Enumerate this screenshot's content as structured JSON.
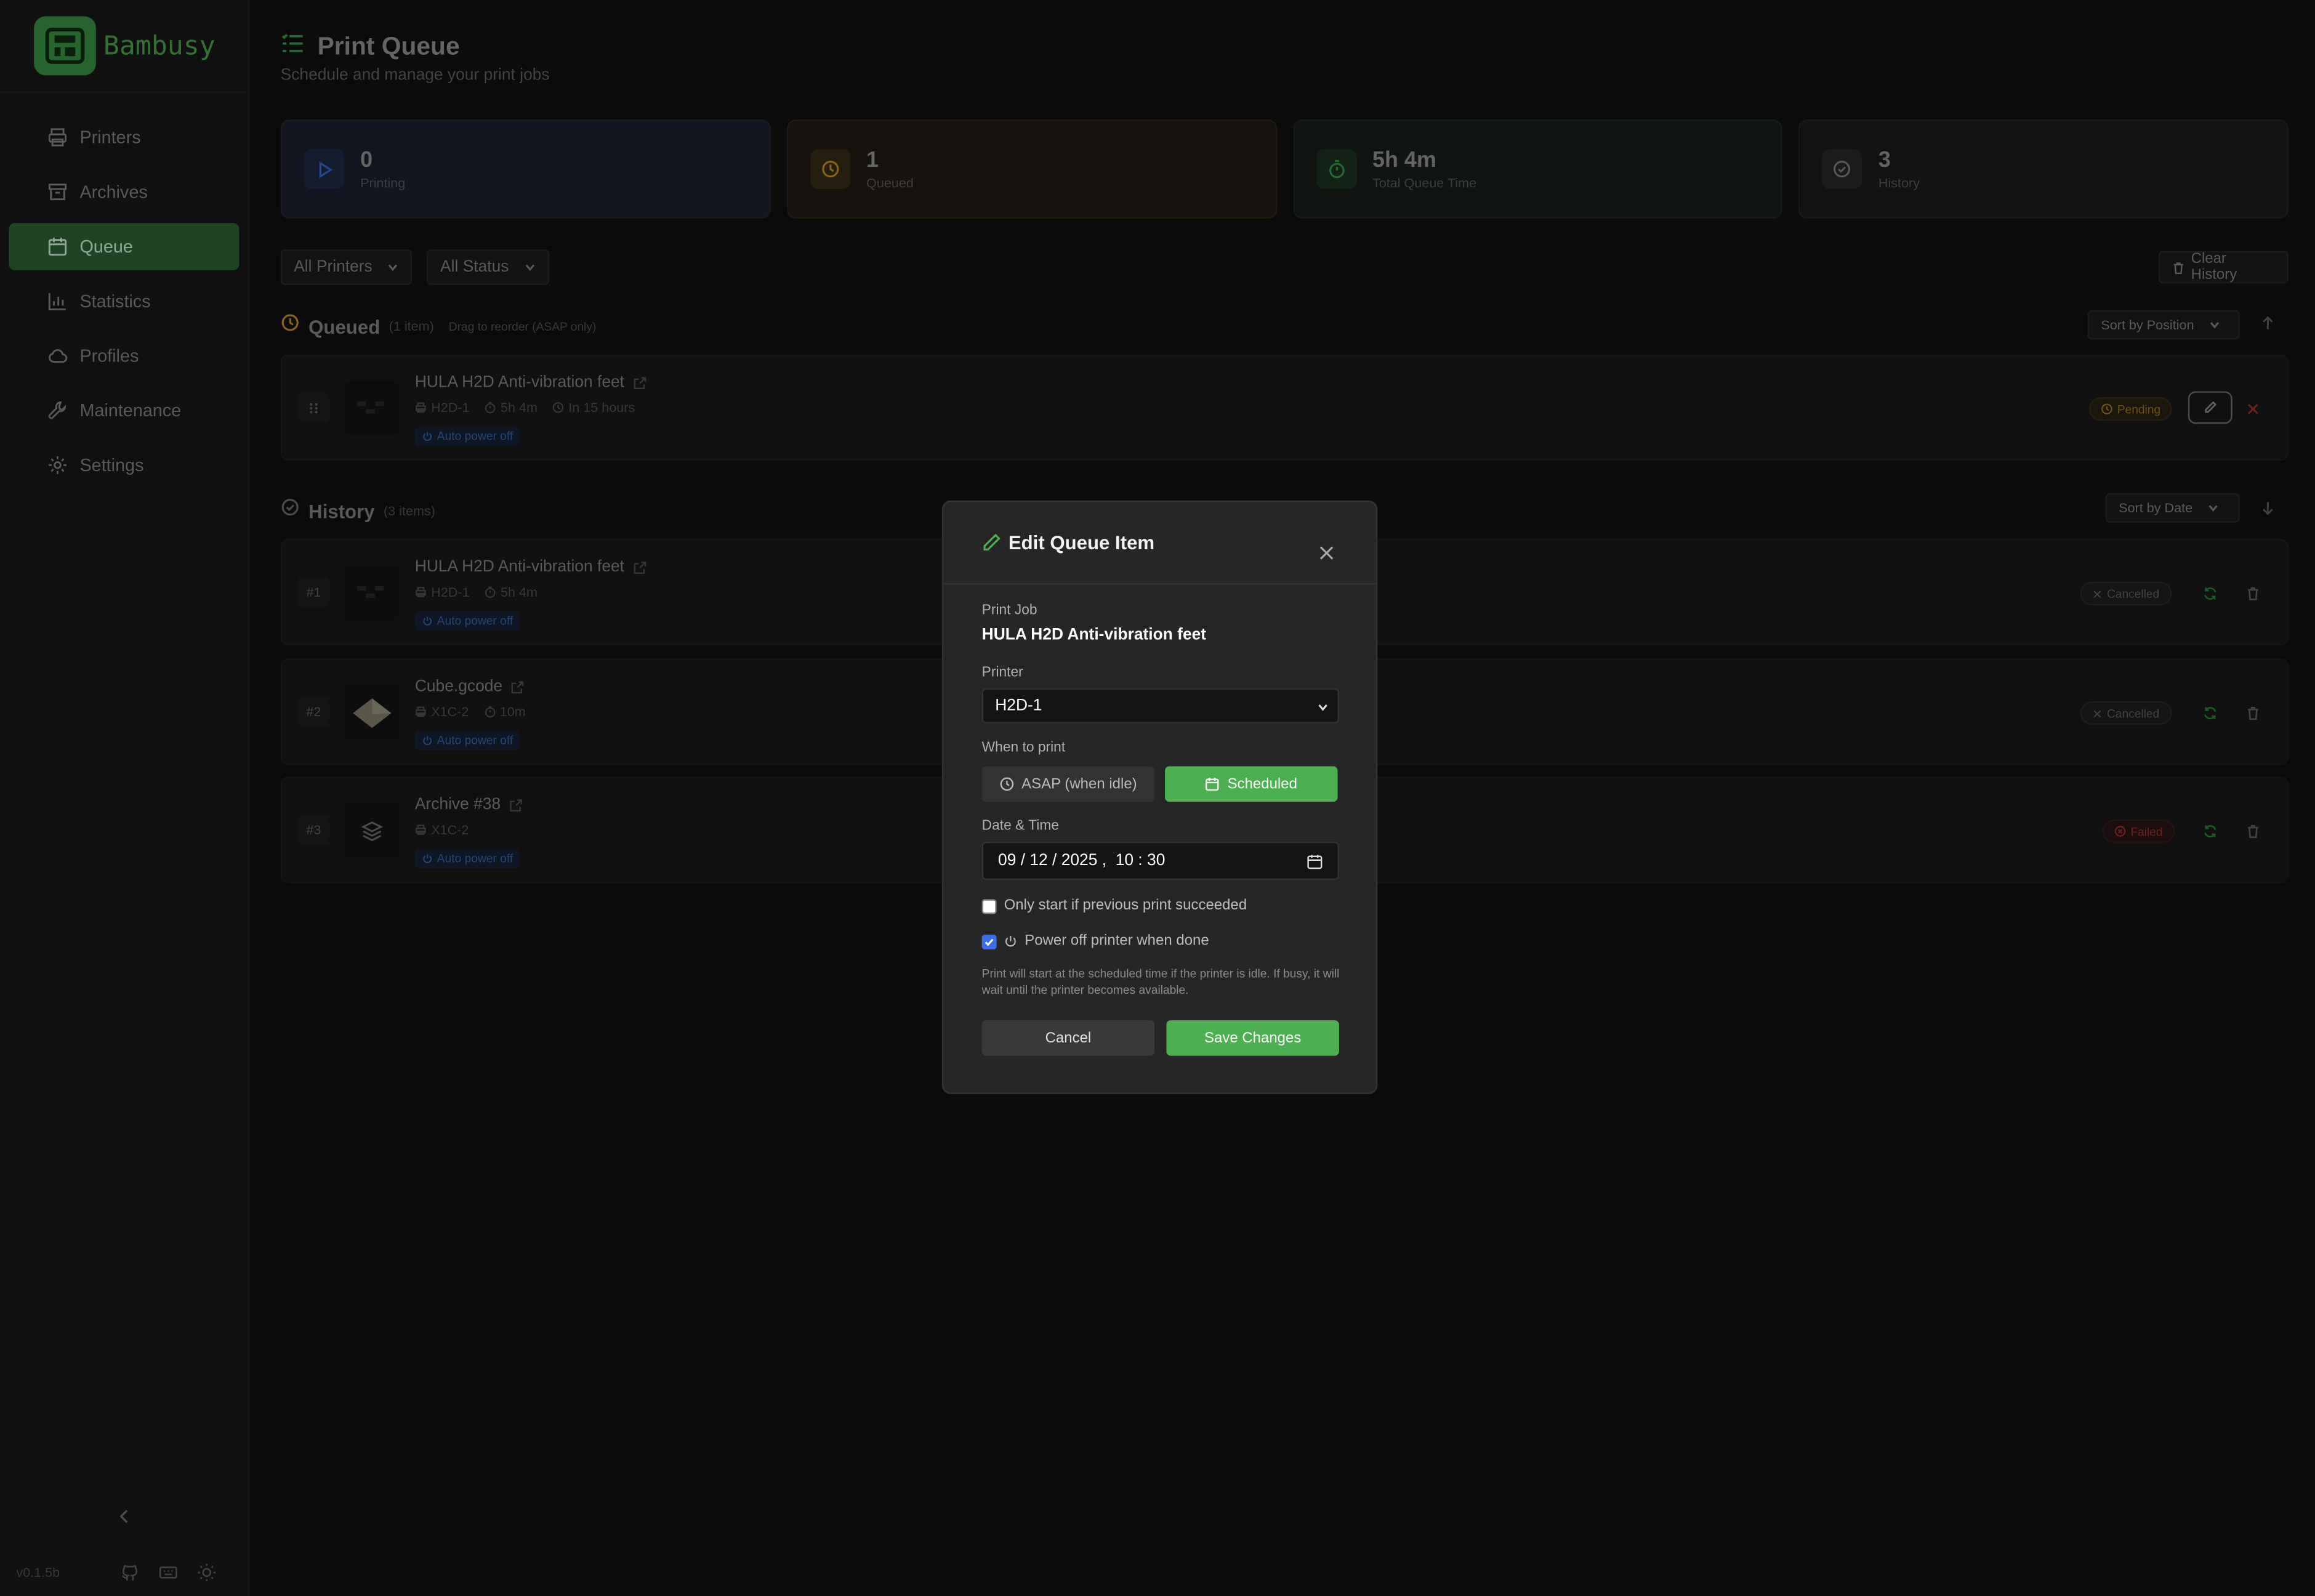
{
  "app": {
    "name": "Bambusy",
    "version": "v0.1.5b"
  },
  "sidebar": {
    "items": [
      {
        "label": "Printers",
        "icon": "printer-icon"
      },
      {
        "label": "Archives",
        "icon": "archive-icon"
      },
      {
        "label": "Queue",
        "icon": "calendar-icon",
        "active": true
      },
      {
        "label": "Statistics",
        "icon": "bar-chart-icon"
      },
      {
        "label": "Profiles",
        "icon": "cloud-icon"
      },
      {
        "label": "Maintenance",
        "icon": "wrench-icon"
      },
      {
        "label": "Settings",
        "icon": "gear-icon"
      }
    ]
  },
  "page": {
    "title": "Print Queue",
    "subtitle": "Schedule and manage your print jobs"
  },
  "stats": [
    {
      "value": "0",
      "label": "Printing",
      "color": "#3b6ee8"
    },
    {
      "value": "1",
      "label": "Queued",
      "color": "#d39a26"
    },
    {
      "value": "5h 4m",
      "label": "Total Queue Time",
      "color": "#3fa34d"
    },
    {
      "value": "3",
      "label": "History",
      "color": "#888888"
    }
  ],
  "filters": {
    "printers": "All Printers",
    "status": "All Status",
    "clear_history": "Clear History"
  },
  "queued": {
    "title": "Queued",
    "count": "(1 item)",
    "hint": "Drag to reorder (ASAP only)",
    "sort": "Sort by Position",
    "items": [
      {
        "name": "HULA H2D Anti-vibration feet",
        "printer": "H2D-1",
        "duration": "5h 4m",
        "eta": "In 15 hours",
        "apo": "Auto power off",
        "status": "Pending"
      }
    ]
  },
  "history": {
    "title": "History",
    "count": "(3 items)",
    "sort": "Sort by Date",
    "items": [
      {
        "num": "#1",
        "name": "HULA H2D Anti-vibration feet",
        "printer": "H2D-1",
        "duration": "5h 4m",
        "apo": "Auto power off",
        "status": "Cancelled"
      },
      {
        "num": "#2",
        "name": "Cube.gcode",
        "printer": "X1C-2",
        "duration": "10m",
        "apo": "Auto power off",
        "status": "Cancelled"
      },
      {
        "num": "#3",
        "name": "Archive #38",
        "printer": "X1C-2",
        "duration": "",
        "apo": "Auto power off",
        "status": "Failed"
      }
    ]
  },
  "modal": {
    "title": "Edit Queue Item",
    "print_job_label": "Print Job",
    "print_job_value": "HULA H2D Anti-vibration feet",
    "printer_label": "Printer",
    "printer_value": "H2D-1",
    "when_label": "When to print",
    "asap_label": "ASAP (when idle)",
    "scheduled_label": "Scheduled",
    "datetime_label": "Date & Time",
    "datetime_value": "09 / 12 / 2025 ,  10 : 30",
    "only_start_label": "Only start if previous print succeeded",
    "only_start_checked": false,
    "power_off_label": "Power off printer when done",
    "power_off_checked": true,
    "note": "Print will start at the scheduled time if the printer is idle. If busy, it will wait until the printer becomes available.",
    "cancel_label": "Cancel",
    "save_label": "Save Changes"
  },
  "colors": {
    "accent": "#4caf50",
    "pending": "#d39a26",
    "failed": "#c0392b",
    "info": "#3b6ee8"
  }
}
